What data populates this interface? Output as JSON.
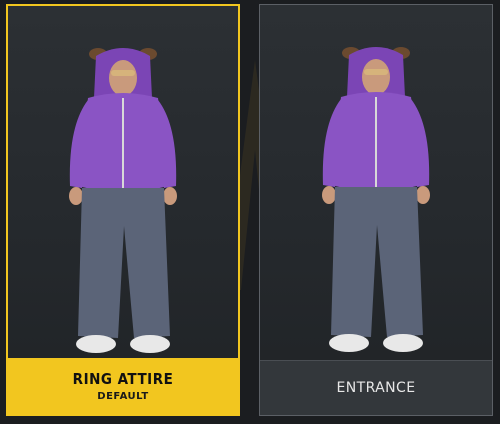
{
  "cards": [
    {
      "title": "RING ATTIRE",
      "subtitle": "DEFAULT",
      "selected": true
    },
    {
      "title": "ENTRANCE",
      "subtitle": "",
      "selected": false
    }
  ],
  "colors": {
    "accent": "#f2c61f",
    "hoodie": "#8a54c4",
    "jeans": "#5b6478",
    "background": "#1b1d20"
  }
}
